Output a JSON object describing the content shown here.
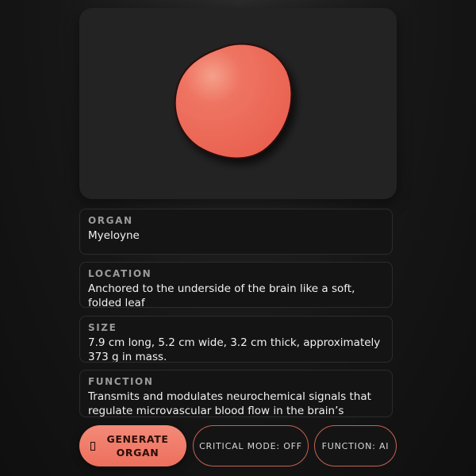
{
  "colors": {
    "accent": "#ee6f5d",
    "organ_fill": "#ed6a5a",
    "card_background": "#232323",
    "info_background": "#141414"
  },
  "preview": {
    "organ_shape": "rounded-blob"
  },
  "info": {
    "organ": {
      "label": "ORGAN",
      "value": "Myeloyne"
    },
    "location": {
      "label": "LOCATION",
      "value": "Anchored to the underside of the brain like a soft, folded leaf"
    },
    "size": {
      "label": "SIZE",
      "value": "7.9 cm long, 5.2 cm wide, 3.2 cm thick, approximately 373 g in mass."
    },
    "function": {
      "label": "FUNCTION",
      "value": "Transmits and modulates neurochemical signals that regulate microvascular blood flow in the brain’s cortical"
    }
  },
  "actions": {
    "generate": {
      "icon": "dice-icon",
      "label": "GENERATE ORGAN"
    },
    "critical_mode": {
      "label": "CRITICAL MODE: OFF"
    },
    "function_mode": {
      "label": "FUNCTION: AI"
    }
  }
}
